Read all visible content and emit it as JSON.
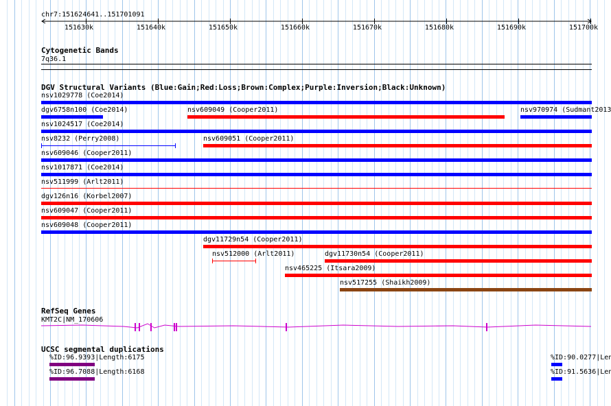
{
  "ruler": {
    "position": "chr7:151624641..151701091",
    "ticks": [
      "151630k",
      "151640k",
      "151650k",
      "151660k",
      "151670k",
      "151680k",
      "151690k",
      "151700k"
    ]
  },
  "cytoband": {
    "title": "Cytogenetic Bands",
    "band": "7q36.1"
  },
  "dgv": {
    "title": "DGV Structural Variants (Blue:Gain;Red:Loss;Brown:Complex;Purple:Inversion;Black:Unknown)",
    "colors": {
      "gain": "#0000ff",
      "loss": "#ff0000",
      "complex": "#8b4513",
      "inversion": "#800080",
      "unknown": "#000000"
    },
    "variants": [
      {
        "label": "nsv1029778 (Coe2014)",
        "type": "gain"
      },
      {
        "label": "dgv6758n100 (Coe2014)",
        "type": "gain"
      },
      {
        "label": "nsv609049 (Cooper2011)",
        "type": "loss"
      },
      {
        "label": "nsv970974 (Sudmant2013",
        "type": "gain"
      },
      {
        "label": "nsv1024517 (Coe2014)",
        "type": "gain"
      },
      {
        "label": "nsv8232 (Perry2008)",
        "type": "gain"
      },
      {
        "label": "nsv609051 (Cooper2011)",
        "type": "loss"
      },
      {
        "label": "nsv609046 (Cooper2011)",
        "type": "gain"
      },
      {
        "label": "nsv1017871 (Coe2014)",
        "type": "gain"
      },
      {
        "label": "nsv511999 (Arlt2011)",
        "type": "loss"
      },
      {
        "label": "dgv126n16 (Korbel2007)",
        "type": "loss"
      },
      {
        "label": "nsv609047 (Cooper2011)",
        "type": "loss"
      },
      {
        "label": "nsv609048 (Cooper2011)",
        "type": "gain"
      },
      {
        "label": "dgv11729n54 (Cooper2011)",
        "type": "loss"
      },
      {
        "label": "nsv512000 (Arlt2011)",
        "type": "loss"
      },
      {
        "label": "dgv11730n54 (Cooper2011)",
        "type": "loss"
      },
      {
        "label": "nsv465225 (Itsara2009)",
        "type": "loss"
      },
      {
        "label": "nsv517255 (Shaikh2009)",
        "type": "complex"
      }
    ]
  },
  "refseq": {
    "title": "RefSeq Genes",
    "gene": "KMT2C|NM_170606",
    "color": "#cc00cc"
  },
  "segdup": {
    "title": "UCSC segmental duplications",
    "items": [
      {
        "label": "%ID:96.9393|Length:6175",
        "color": "#800080"
      },
      {
        "label": "%ID:96.7088|Length:6168",
        "color": "#800080"
      },
      {
        "label": "%ID:90.0277|Len",
        "color": "#0000ff"
      },
      {
        "label": "%ID:91.5636|Len",
        "color": "#0000ff"
      }
    ]
  }
}
